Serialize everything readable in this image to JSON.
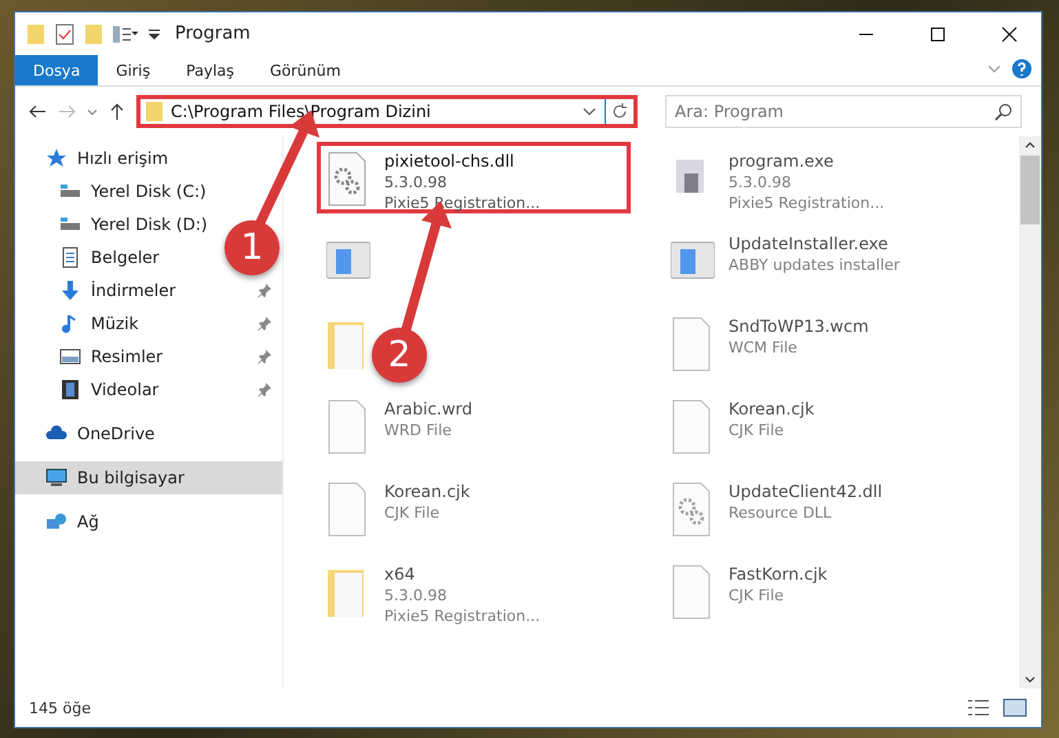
{
  "window": {
    "title": "Program"
  },
  "ribbon_tabs": [
    {
      "label": "Dosya",
      "selected": true
    },
    {
      "label": "Giriş",
      "selected": false
    },
    {
      "label": "Paylaş",
      "selected": false
    },
    {
      "label": "Görünüm",
      "selected": false
    }
  ],
  "address": {
    "path": "C:\\Program Files\\Program Dizini",
    "highlighted": true
  },
  "search": {
    "placeholder": "Ara: Program"
  },
  "sidebar": {
    "items": [
      {
        "label": "Hızlı erişim",
        "kind": "star",
        "pinned": false,
        "selected": false,
        "children": [
          {
            "label": "Yerel Disk (C:)",
            "kind": "drive",
            "pinned": false,
            "selected": false
          },
          {
            "label": "Yerel Disk (D:)",
            "kind": "drive",
            "pinned": false,
            "selected": false
          },
          {
            "label": "Belgeler",
            "kind": "docs",
            "pinned": false,
            "selected": false
          },
          {
            "label": "İndirmeler",
            "kind": "download",
            "pinned": true,
            "selected": false
          },
          {
            "label": "Müzik",
            "kind": "music",
            "pinned": true,
            "selected": false
          },
          {
            "label": "Resimler",
            "kind": "pictures",
            "pinned": true,
            "selected": false
          },
          {
            "label": "Videolar",
            "kind": "video",
            "pinned": true,
            "selected": false
          }
        ]
      },
      {
        "label": "OneDrive",
        "kind": "cloud",
        "pinned": false,
        "selected": false
      },
      {
        "label": "Bu bilgisayar",
        "kind": "pc",
        "pinned": false,
        "selected": true
      },
      {
        "label": "Ağ",
        "kind": "network",
        "pinned": false,
        "selected": false
      }
    ]
  },
  "files": [
    {
      "kind": "gear",
      "lines": [
        "pixietool-chs.dll",
        "5.3.0.98",
        "Pixie5 Registration..."
      ],
      "highlighted": true
    },
    {
      "kind": "exe",
      "lines": [
        "program.exe",
        "5.3.0.98",
        "Pixie5 Registration..."
      ],
      "highlighted": false
    },
    {
      "kind": "installer",
      "highlighted": false
    },
    {
      "kind": "installer",
      "lines": [
        "UpdateInstaller.exe",
        "ABBY updates installer"
      ],
      "highlighted": false
    },
    {
      "kind": "folder",
      "highlighted": false
    },
    {
      "kind": "doc",
      "lines": [
        "SndToWP13.wcm",
        "WCM File"
      ],
      "highlighted": false
    },
    {
      "kind": "doc",
      "lines": [
        "Arabic.wrd",
        "WRD File"
      ],
      "highlighted": false
    },
    {
      "kind": "doc",
      "lines": [
        "Korean.cjk",
        "CJK File"
      ],
      "highlighted": false
    },
    {
      "kind": "doc",
      "lines": [
        "Korean.cjk",
        "CJK File"
      ],
      "highlighted": false
    },
    {
      "kind": "gear",
      "lines": [
        "UpdateClient42.dll",
        "Resource DLL"
      ],
      "highlighted": false
    },
    {
      "kind": "folder",
      "lines": [
        "x64",
        "5.3.0.98",
        "Pixie5 Registration..."
      ],
      "highlighted": false
    },
    {
      "kind": "doc",
      "lines": [
        "FastKorn.cjk",
        "CJK File"
      ],
      "highlighted": false
    }
  ],
  "status_bar": {
    "count": "145 öğe"
  },
  "annotations": [
    {
      "label": "1"
    },
    {
      "label": "2"
    }
  ]
}
